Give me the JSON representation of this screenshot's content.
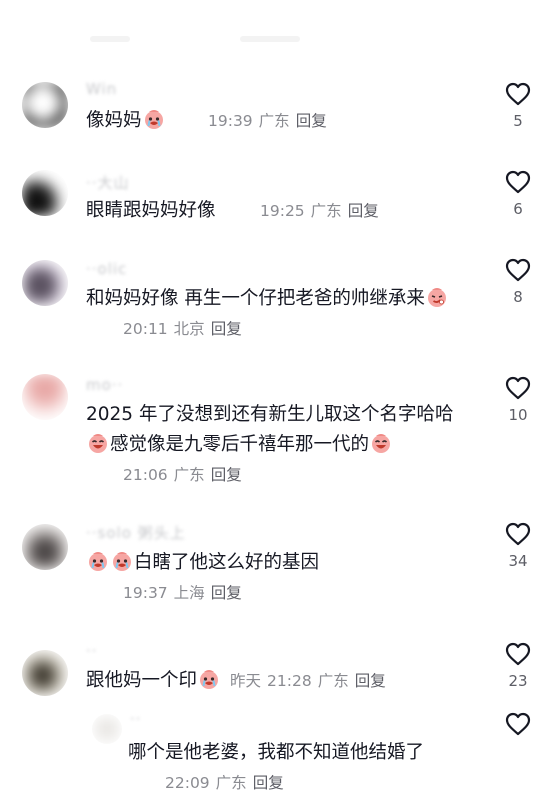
{
  "comments": [
    {
      "username": "Win",
      "text_before": "像妈妈",
      "emoji_before": [],
      "emoji_after": [
        "crying-face"
      ],
      "text_after": "",
      "time": "19:39",
      "location": "广东",
      "reply": "回复",
      "likes": "5"
    },
    {
      "username": "··大山",
      "text_before": "眼睛跟妈妈好像",
      "emoji_before": [],
      "emoji_after": [],
      "text_after": "",
      "time": "19:25",
      "location": "广东",
      "reply": "回复",
      "likes": "6"
    },
    {
      "username": "··olic",
      "text_before": "和妈妈好像 再生一个仔把老爸的帅继承来",
      "emoji_before": [],
      "emoji_after": [
        "sly-face"
      ],
      "text_after": "",
      "time": "20:11",
      "location": "北京",
      "reply": "回复",
      "likes": "8"
    },
    {
      "username": "mo··",
      "line1": "2025 年了没想到还有新生儿取这个名字哈哈",
      "text_before": "感觉像是九零后千禧年那一代的",
      "emoji_before": [
        "laughing-face"
      ],
      "emoji_after": [
        "laughing-face"
      ],
      "text_after": "",
      "time": "21:06",
      "location": "广东",
      "reply": "回复",
      "likes": "10"
    },
    {
      "username": "··solo 粥头上",
      "text_before": "白瞎了他这么好的基因",
      "emoji_before": [
        "crying-face",
        "crying-face"
      ],
      "emoji_after": [],
      "text_after": "",
      "time": "19:37",
      "location": "上海",
      "reply": "回复",
      "likes": "34"
    },
    {
      "username": "··",
      "text_before": "跟他妈一个印",
      "emoji_before": [],
      "emoji_after": [
        "crying-face"
      ],
      "text_after": "",
      "date": "昨天",
      "time": "21:28",
      "location": "广东",
      "reply": "回复",
      "likes": "23"
    },
    {
      "username": "··",
      "text_before": "哪个是他老婆，我都不知道他结婚了",
      "emoji_before": [],
      "emoji_after": [],
      "text_after": "",
      "time": "22:09",
      "location": "广东",
      "reply": "回复",
      "likes": ""
    }
  ],
  "colors": {
    "text": "#161823",
    "meta": "#8a8b91",
    "heart": "#161823"
  },
  "icons": {
    "like": "heart-outline-icon",
    "emoji_crying": "crying-face-emoji",
    "emoji_laughing": "laughing-face-emoji",
    "emoji_sly": "sly-face-emoji"
  }
}
